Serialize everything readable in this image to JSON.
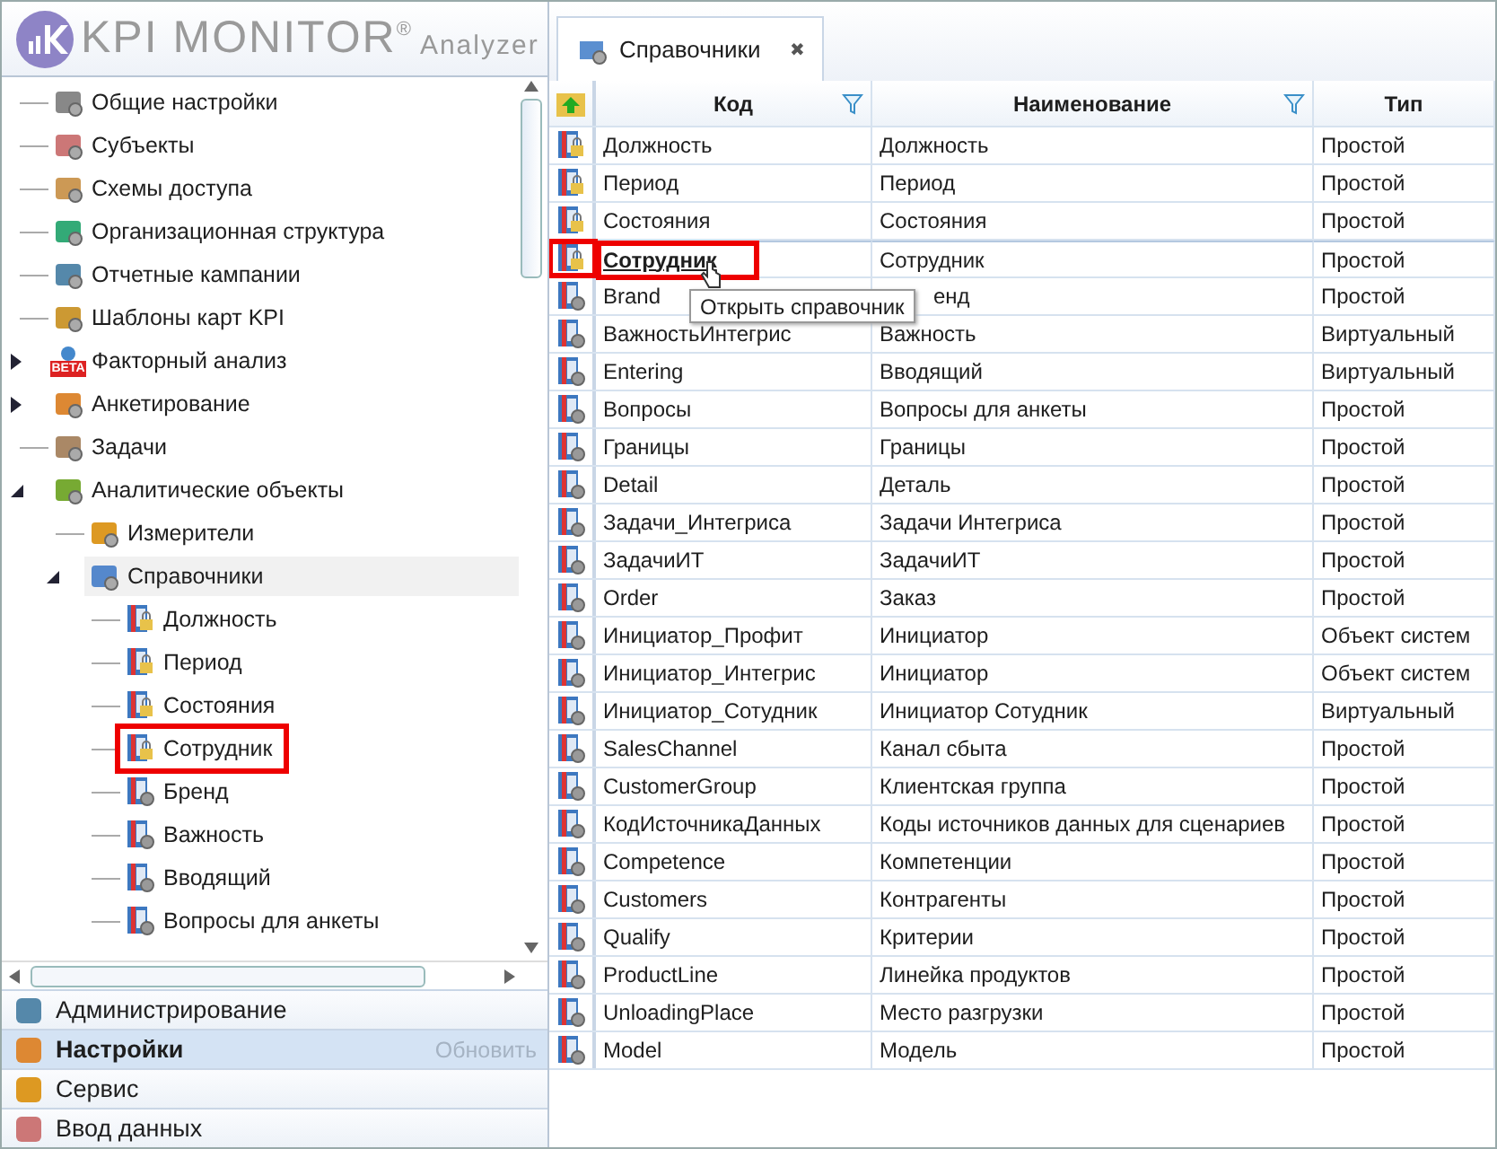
{
  "logo": {
    "name": "KPI MONITOR",
    "mark": "®",
    "subtitle": "Analyzer"
  },
  "tree": [
    {
      "label": "Общие настройки"
    },
    {
      "label": "Субъекты"
    },
    {
      "label": "Схемы доступа"
    },
    {
      "label": "Организационная структура"
    },
    {
      "label": "Отчетные кампании"
    },
    {
      "label": "Шаблоны карт KPI"
    },
    {
      "label": "Факторный анализ",
      "expanded": false,
      "badge": "BETA"
    },
    {
      "label": "Анкетирование",
      "expanded": false
    },
    {
      "label": "Задачи"
    },
    {
      "label": "Аналитические объекты",
      "expanded": true,
      "children": [
        {
          "label": "Измерители"
        },
        {
          "label": "Справочники",
          "expanded": true,
          "selected": true,
          "children": [
            {
              "label": "Должность",
              "locked": true,
              "highlighted": false
            },
            {
              "label": "Период",
              "locked": true,
              "highlighted": false
            },
            {
              "label": "Состояния",
              "locked": true,
              "highlighted": false
            },
            {
              "label": "Сотрудник",
              "locked": true,
              "highlighted": true
            },
            {
              "label": "Бренд",
              "locked": false,
              "highlighted": false
            },
            {
              "label": "Важность",
              "locked": false,
              "highlighted": false
            },
            {
              "label": "Вводящий",
              "locked": false,
              "highlighted": false
            },
            {
              "label": "Вопросы для анкеты",
              "locked": false,
              "highlighted": false
            }
          ]
        }
      ]
    }
  ],
  "nav": [
    {
      "label": "Администрирование",
      "selected": false
    },
    {
      "label": "Настройки",
      "selected": true,
      "action": "Обновить"
    },
    {
      "label": "Сервис",
      "selected": false
    },
    {
      "label": "Ввод данных",
      "selected": false
    }
  ],
  "tab": {
    "label": "Справочники",
    "close": "✖"
  },
  "grid": {
    "columns": [
      "Код",
      "Наименование",
      "Тип"
    ],
    "tooltip": "Открыть справочник",
    "rows": [
      {
        "code": "Должность",
        "name": "Должность",
        "type": "Простой",
        "locked": true,
        "hovered": false,
        "highlighted": false
      },
      {
        "code": "Период",
        "name": "Период",
        "type": "Простой",
        "locked": true,
        "hovered": false,
        "highlighted": false
      },
      {
        "code": "Состояния",
        "name": "Состояния",
        "type": "Простой",
        "locked": true,
        "hovered": false,
        "highlighted": false
      },
      {
        "code": "Сотрудник",
        "name": "Сотрудник",
        "type": "Простой",
        "locked": true,
        "hovered": true,
        "highlighted": true
      },
      {
        "code": "Brand",
        "name": "енд",
        "type": "Простой",
        "locked": false,
        "hovered": false,
        "highlighted": false
      },
      {
        "code": "ВажностьИнтегрис",
        "name": "Важность",
        "type": "Виртуальный",
        "locked": false,
        "hovered": false,
        "highlighted": false
      },
      {
        "code": "Entering",
        "name": "Вводящий",
        "type": "Виртуальный",
        "locked": false,
        "hovered": false,
        "highlighted": false
      },
      {
        "code": "Вопросы",
        "name": "Вопросы для анкеты",
        "type": "Простой",
        "locked": false,
        "hovered": false,
        "highlighted": false
      },
      {
        "code": "Границы",
        "name": "Границы",
        "type": "Простой",
        "locked": false,
        "hovered": false,
        "highlighted": false
      },
      {
        "code": "Detail",
        "name": "Деталь",
        "type": "Простой",
        "locked": false,
        "hovered": false,
        "highlighted": false
      },
      {
        "code": "Задачи_Интегриса",
        "name": "Задачи Интегриса",
        "type": "Простой",
        "locked": false,
        "hovered": false,
        "highlighted": false
      },
      {
        "code": "ЗадачиИТ",
        "name": "ЗадачиИТ",
        "type": "Простой",
        "locked": false,
        "hovered": false,
        "highlighted": false
      },
      {
        "code": "Order",
        "name": "Заказ",
        "type": "Простой",
        "locked": false,
        "hovered": false,
        "highlighted": false
      },
      {
        "code": "Инициатор_Профит",
        "name": "Инициатор",
        "type": "Объект систем",
        "locked": false,
        "hovered": false,
        "highlighted": false
      },
      {
        "code": "Инициатор_Интегрис",
        "name": "Инициатор",
        "type": "Объект систем",
        "locked": false,
        "hovered": false,
        "highlighted": false
      },
      {
        "code": "Инициатор_Сотудник",
        "name": "Инициатор Сотудник",
        "type": "Виртуальный",
        "locked": false,
        "hovered": false,
        "highlighted": false
      },
      {
        "code": "SalesChannel",
        "name": "Канал сбыта",
        "type": "Простой",
        "locked": false,
        "hovered": false,
        "highlighted": false
      },
      {
        "code": "CustomerGroup",
        "name": "Клиентская группа",
        "type": "Простой",
        "locked": false,
        "hovered": false,
        "highlighted": false
      },
      {
        "code": "КодИсточникаДанных",
        "name": "Коды источников данных для сценариев",
        "type": "Простой",
        "locked": false,
        "hovered": false,
        "highlighted": false
      },
      {
        "code": "Competence",
        "name": "Компетенции",
        "type": "Простой",
        "locked": false,
        "hovered": false,
        "highlighted": false
      },
      {
        "code": "Customers",
        "name": "Контрагенты",
        "type": "Простой",
        "locked": false,
        "hovered": false,
        "highlighted": false
      },
      {
        "code": "Qualify",
        "name": "Критерии",
        "type": "Простой",
        "locked": false,
        "hovered": false,
        "highlighted": false
      },
      {
        "code": "ProductLine",
        "name": "Линейка продуктов",
        "type": "Простой",
        "locked": false,
        "hovered": false,
        "highlighted": false
      },
      {
        "code": "UnloadingPlace",
        "name": "Место разгрузки",
        "type": "Простой",
        "locked": false,
        "hovered": false,
        "highlighted": false
      },
      {
        "code": "Model",
        "name": "Модель",
        "type": "Простой",
        "locked": false,
        "hovered": false,
        "highlighted": false
      }
    ]
  }
}
